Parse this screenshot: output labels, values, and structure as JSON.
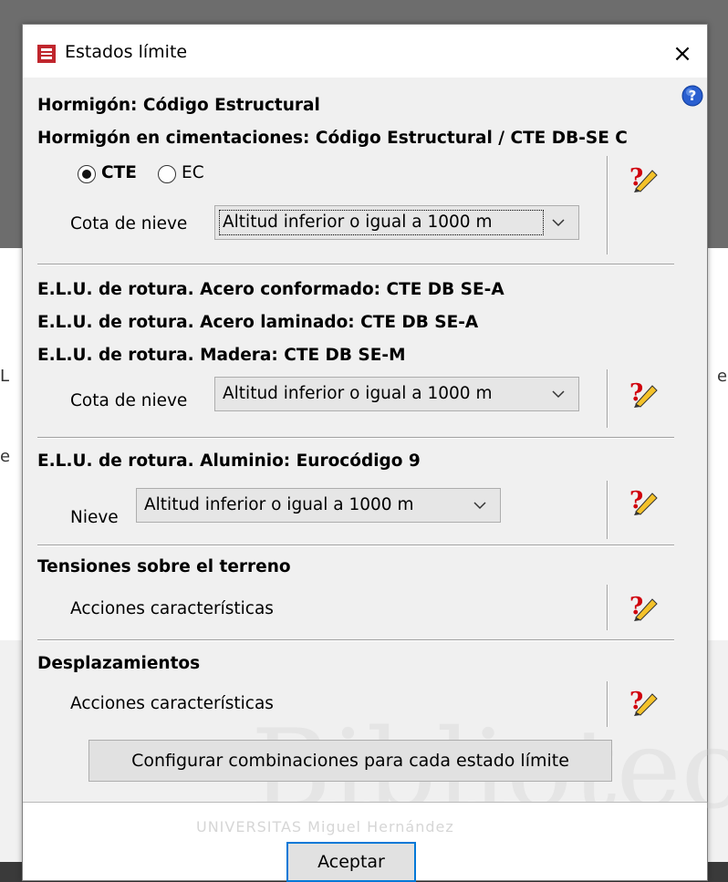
{
  "window": {
    "title": "Estados límite",
    "close": "×",
    "help": "?"
  },
  "sections": {
    "hormigon": "Hormigón: Código Estructural",
    "cimentaciones": "Hormigón en cimentaciones: Código Estructural / CTE DB-SE C",
    "radio_cte": "CTE",
    "radio_ec": "EC",
    "radio_selected": "CTE",
    "cota_label_1": "Cota de nieve",
    "cota_value_1": "Altitud inferior o igual a 1000 m",
    "acero_conformado": "E.L.U. de rotura. Acero conformado: CTE DB SE-A",
    "acero_laminado": "E.L.U. de rotura. Acero laminado: CTE DB SE-A",
    "madera": "E.L.U. de rotura. Madera: CTE DB SE-M",
    "cota_label_2": "Cota de nieve",
    "cota_value_2": "Altitud inferior o igual a 1000 m",
    "aluminio": "E.L.U. de rotura. Aluminio: Eurocódigo 9",
    "nieve_label": "Nieve",
    "nieve_value": "Altitud inferior o igual a 1000 m",
    "tensiones": "Tensiones sobre el terreno",
    "acciones_1": "Acciones características",
    "desplazamientos": "Desplazamientos",
    "acciones_2": "Acciones características"
  },
  "buttons": {
    "configurar": "Configurar combinaciones para cada estado límite",
    "aceptar": "Aceptar"
  },
  "background": {
    "letter_left_1": "L",
    "letter_left_2": "e",
    "letter_right": "e",
    "watermark": "Biblioteca",
    "watermark_sub": "UNIVERSITAS Miguel Hernández"
  },
  "colors": {
    "accent": "#0078d7",
    "dialog_bg": "#f0f0f0"
  }
}
